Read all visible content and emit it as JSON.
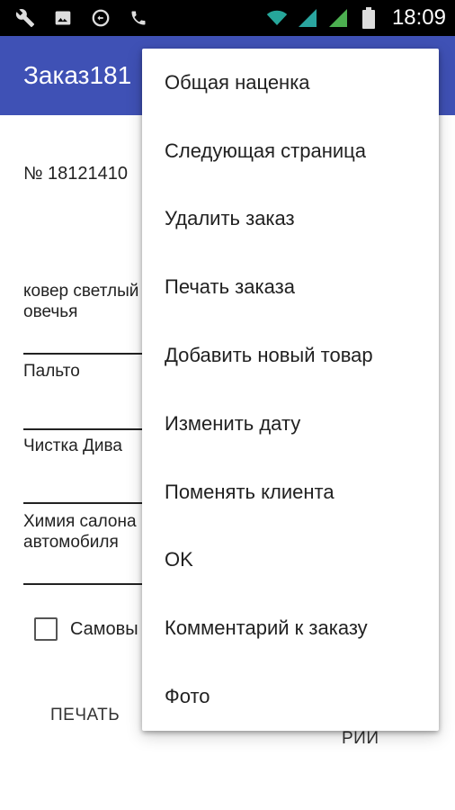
{
  "status_bar": {
    "time": "18:09",
    "icons": [
      "wrench-icon",
      "image-icon",
      "sync-icon",
      "phone-icon",
      "wifi-icon",
      "signal-icon",
      "signal-icon",
      "battery-icon"
    ]
  },
  "app_bar": {
    "title": "Заказ181"
  },
  "order": {
    "number": "№ 18121410"
  },
  "items": [
    {
      "label": "ковер светлый овечья"
    },
    {
      "label": "Пальто"
    },
    {
      "label": "Чистка Дива"
    },
    {
      "label": "Химия салона автомобиля"
    }
  ],
  "checkbox": {
    "label": "Самовы",
    "checked": false
  },
  "buttons": {
    "print": "ПЕЧАТЬ",
    "other": "РИИ"
  },
  "menu": {
    "items": [
      "Общая наценка",
      "Следующая страница",
      "Удалить заказ",
      "Печать заказа",
      "Добавить новый товар",
      "Изменить дату",
      "Поменять клиента",
      "OK",
      "Комментарий к заказу",
      "Фото"
    ]
  },
  "colors": {
    "app_bar": "#3f51b5",
    "status_bar": "#000000",
    "signal_green": "#4caf50",
    "wifi_teal": "#26a69a"
  }
}
